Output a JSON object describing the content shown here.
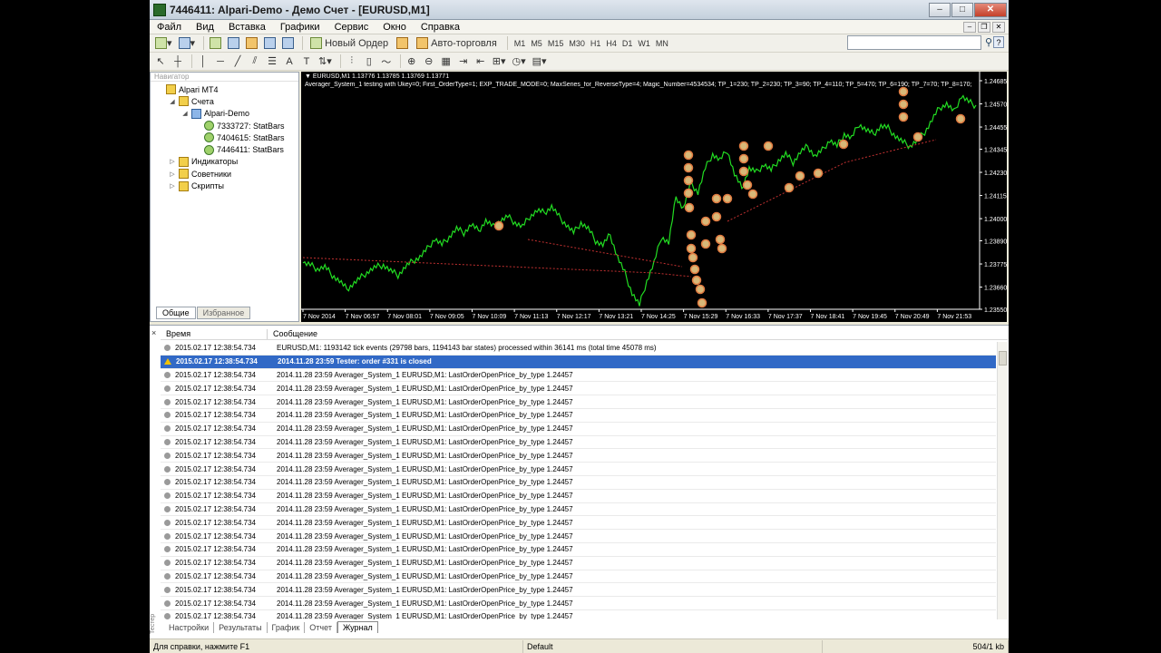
{
  "window": {
    "title": "7446411: Alpari-Demo - Демо Счет - [EURUSD,M1]",
    "buttons": {
      "minimize": "–",
      "maximize": "□",
      "close": "✕"
    }
  },
  "menu": {
    "items": [
      "Файл",
      "Вид",
      "Вставка",
      "Графики",
      "Сервис",
      "Окно",
      "Справка"
    ]
  },
  "toolbar": {
    "new_order": "Новый Ордер",
    "auto_trading": "Авто-торговля",
    "timeframes": [
      "M1",
      "M5",
      "M15",
      "M30",
      "H1",
      "H4",
      "D1",
      "W1",
      "MN"
    ],
    "text_tool": "A"
  },
  "navigator": {
    "header": "Навигатор",
    "tree": [
      {
        "label": "Alpari MT4",
        "level": 0,
        "icon": "folder-icon",
        "exp": ""
      },
      {
        "label": "Счета",
        "level": 1,
        "icon": "folder-icon",
        "exp": "◢"
      },
      {
        "label": "Alpari-Demo",
        "level": 2,
        "icon": "account-icon",
        "exp": "◢"
      },
      {
        "label": "7333727: StatBars",
        "level": 3,
        "icon": "user-icon",
        "exp": ""
      },
      {
        "label": "7404615: StatBars",
        "level": 3,
        "icon": "user-icon",
        "exp": ""
      },
      {
        "label": "7446411: StatBars",
        "level": 3,
        "icon": "user-icon",
        "exp": ""
      },
      {
        "label": "Индикаторы",
        "level": 1,
        "icon": "folder-icon",
        "exp": "▷"
      },
      {
        "label": "Советники",
        "level": 1,
        "icon": "folder-icon",
        "exp": "▷"
      },
      {
        "label": "Скрипты",
        "level": 1,
        "icon": "folder-icon",
        "exp": "▷"
      }
    ],
    "tabs": [
      "Общие",
      "Избранное"
    ]
  },
  "chart": {
    "header": "▼ EURUSD,M1  1.13776 1.13785 1.13769 1.13771",
    "info": "Averager_System_1 testing with Ukey=0; First_OrderType=1; EXP_TRADE_MODE=0; MaxSeries_for_ReverseType=4; Magic_Number=4534534; TP_1=230; TP_2=230; TP_3=90; TP_4=110; TP_5=470; TP_6=190; TP_7=70; TP_8=170;",
    "price_labels": [
      "1.24685",
      "1.24570",
      "1.24455",
      "1.24345",
      "1.24230",
      "1.24115",
      "1.24000",
      "1.23890",
      "1.23775",
      "1.23660",
      "1.23550"
    ],
    "time_labels": [
      "7 Nov 2014",
      "7 Nov 06:57",
      "7 Nov 08:01",
      "7 Nov 09:05",
      "7 Nov 10:09",
      "7 Nov 11:13",
      "7 Nov 12:17",
      "7 Nov 13:21",
      "7 Nov 14:25",
      "7 Nov 15:29",
      "7 Nov 16:33",
      "7 Nov 17:37",
      "7 Nov 18:41",
      "7 Nov 19:45",
      "7 Nov 20:49",
      "7 Nov 21:53"
    ],
    "price_min": 1.2355,
    "price_max": 1.24685,
    "colors": {
      "line": "#22dd22",
      "bg": "#000000",
      "marker": "#e07a40"
    },
    "series": [
      1.2378,
      1.2377,
      1.2375,
      1.2376,
      1.2372,
      1.2369,
      1.2365,
      1.2368,
      1.2371,
      1.2374,
      1.2376,
      1.2377,
      1.2374,
      1.2372,
      1.2376,
      1.2379,
      1.2381,
      1.2385,
      1.239,
      1.2387,
      1.2391,
      1.2395,
      1.2393,
      1.2397,
      1.2394,
      1.2399,
      1.2396,
      1.2399,
      1.2401,
      1.2398,
      1.2396,
      1.2401,
      1.2404,
      1.2403,
      1.2406,
      1.2401,
      1.2397,
      1.2393,
      1.2398,
      1.2395,
      1.2389,
      1.2387,
      1.2392,
      1.2381,
      1.2373,
      1.2363,
      1.2357,
      1.2369,
      1.2378,
      1.2391,
      1.2388,
      1.2411,
      1.2405,
      1.2418,
      1.2413,
      1.2425,
      1.2432,
      1.2429,
      1.2434,
      1.2422,
      1.2415,
      1.2425,
      1.2423,
      1.2427,
      1.2424,
      1.2429,
      1.2432,
      1.2428,
      1.2433,
      1.2436,
      1.2431,
      1.2434,
      1.2439,
      1.2436,
      1.2442,
      1.244,
      1.2447,
      1.2444,
      1.2442,
      1.2446,
      1.2445,
      1.2441,
      1.2438,
      1.2436,
      1.2439,
      1.2443,
      1.2449,
      1.2455,
      1.2457,
      1.2453,
      1.2461,
      1.2458,
      1.2456
    ]
  },
  "terminal": {
    "close": "×",
    "columns": {
      "time": "Время",
      "message": "Сообщение"
    },
    "rows": [
      {
        "time": "2015.02.17 12:38:54.734",
        "msg": "EURUSD,M1: 1193142 tick events (29798 bars, 1194143 bar states) processed within 36141 ms (total time 45078 ms)",
        "type": "info"
      },
      {
        "time": "2015.02.17 12:38:54.734",
        "msg": "2014.11.28 23:59  Tester: order #331 is closed",
        "type": "warn"
      },
      {
        "time": "2015.02.17 12:38:54.734",
        "msg": "2014.11.28 23:59  Averager_System_1 EURUSD,M1: LastOrderOpenPrice_by_type 1.24457",
        "type": "info"
      },
      {
        "time": "2015.02.17 12:38:54.734",
        "msg": "2014.11.28 23:59  Averager_System_1 EURUSD,M1: LastOrderOpenPrice_by_type 1.24457",
        "type": "info"
      },
      {
        "time": "2015.02.17 12:38:54.734",
        "msg": "2014.11.28 23:59  Averager_System_1 EURUSD,M1: LastOrderOpenPrice_by_type 1.24457",
        "type": "info"
      },
      {
        "time": "2015.02.17 12:38:54.734",
        "msg": "2014.11.28 23:59  Averager_System_1 EURUSD,M1: LastOrderOpenPrice_by_type 1.24457",
        "type": "info"
      },
      {
        "time": "2015.02.17 12:38:54.734",
        "msg": "2014.11.28 23:59  Averager_System_1 EURUSD,M1: LastOrderOpenPrice_by_type 1.24457",
        "type": "info"
      },
      {
        "time": "2015.02.17 12:38:54.734",
        "msg": "2014.11.28 23:59  Averager_System_1 EURUSD,M1: LastOrderOpenPrice_by_type 1.24457",
        "type": "info"
      },
      {
        "time": "2015.02.17 12:38:54.734",
        "msg": "2014.11.28 23:59  Averager_System_1 EURUSD,M1: LastOrderOpenPrice_by_type 1.24457",
        "type": "info"
      },
      {
        "time": "2015.02.17 12:38:54.734",
        "msg": "2014.11.28 23:59  Averager_System_1 EURUSD,M1: LastOrderOpenPrice_by_type 1.24457",
        "type": "info"
      },
      {
        "time": "2015.02.17 12:38:54.734",
        "msg": "2014.11.28 23:59  Averager_System_1 EURUSD,M1: LastOrderOpenPrice_by_type 1.24457",
        "type": "info"
      },
      {
        "time": "2015.02.17 12:38:54.734",
        "msg": "2014.11.28 23:59  Averager_System_1 EURUSD,M1: LastOrderOpenPrice_by_type 1.24457",
        "type": "info"
      },
      {
        "time": "2015.02.17 12:38:54.734",
        "msg": "2014.11.28 23:59  Averager_System_1 EURUSD,M1: LastOrderOpenPrice_by_type 1.24457",
        "type": "info"
      },
      {
        "time": "2015.02.17 12:38:54.734",
        "msg": "2014.11.28 23:59  Averager_System_1 EURUSD,M1: LastOrderOpenPrice_by_type 1.24457",
        "type": "info"
      },
      {
        "time": "2015.02.17 12:38:54.734",
        "msg": "2014.11.28 23:59  Averager_System_1 EURUSD,M1: LastOrderOpenPrice_by_type 1.24457",
        "type": "info"
      },
      {
        "time": "2015.02.17 12:38:54.734",
        "msg": "2014.11.28 23:59  Averager_System_1 EURUSD,M1: LastOrderOpenPrice_by_type 1.24457",
        "type": "info"
      },
      {
        "time": "2015.02.17 12:38:54.734",
        "msg": "2014.11.28 23:59  Averager_System_1 EURUSD,M1: LastOrderOpenPrice_by_type 1.24457",
        "type": "info"
      },
      {
        "time": "2015.02.17 12:38:54.734",
        "msg": "2014.11.28 23:59  Averager_System_1 EURUSD,M1: LastOrderOpenPrice_by_type 1.24457",
        "type": "info"
      },
      {
        "time": "2015.02.17 12:38:54.734",
        "msg": "2014.11.28 23:59  Averager_System_1 EURUSD,M1: LastOrderOpenPrice_by_type 1.24457",
        "type": "info"
      },
      {
        "time": "2015.02.17 12:38:54.734",
        "msg": "2014.11.28 23:59  Averager_System_1 EURUSD,M1: LastOrderOpenPrice_by_type 1.24457",
        "type": "info"
      },
      {
        "time": "2015.02.17 12:38:54.734",
        "msg": "2014.11.28 23:59  Averager_System_1 EURUSD,M1: LastOrderOpenPrice_by_type 1.24457",
        "type": "info"
      }
    ],
    "tabs": [
      "Настройки",
      "Результаты",
      "График",
      "Отчет",
      "Журнал"
    ],
    "active_tab": "Журнал",
    "side_label": "Тестер"
  },
  "status": {
    "help": "Для справки, нажмите F1",
    "profile": "Default",
    "traffic": "504/1 kb"
  }
}
